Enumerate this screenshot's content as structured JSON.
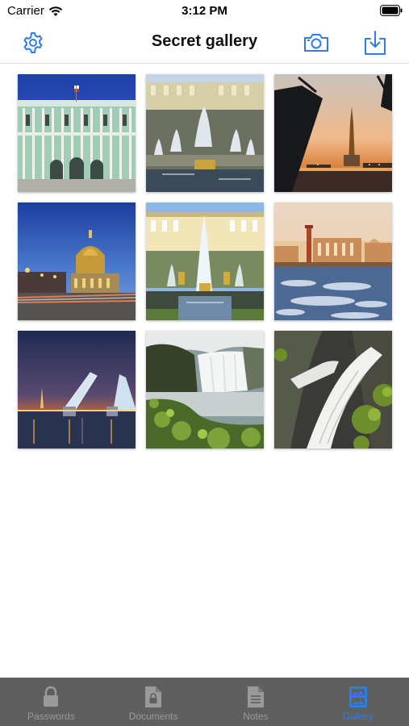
{
  "status_bar": {
    "carrier": "Carrier",
    "time": "3:12 PM"
  },
  "nav": {
    "title": "Secret gallery",
    "left_icon": "settings-gear-icon",
    "right_icons": [
      "camera-icon",
      "import-download-icon"
    ]
  },
  "gallery": {
    "photos": [
      {
        "subject": "palace-facade"
      },
      {
        "subject": "palace-fountains"
      },
      {
        "subject": "drawbridge-cathedral-sunset"
      },
      {
        "subject": "cathedral-dome-night"
      },
      {
        "subject": "grand-cascade-fountain"
      },
      {
        "subject": "rostral-column-winter"
      },
      {
        "subject": "drawbridge-night"
      },
      {
        "subject": "waterfall-green"
      },
      {
        "subject": "waterfall-bw"
      }
    ]
  },
  "tabs": [
    {
      "label": "Passwords",
      "icon": "lock-icon",
      "active": false
    },
    {
      "label": "Documents",
      "icon": "document-lock-icon",
      "active": false
    },
    {
      "label": "Notes",
      "icon": "note-icon",
      "active": false
    },
    {
      "label": "Gallery",
      "icon": "gallery-icon",
      "active": true
    }
  ],
  "colors": {
    "accent": "#2f7de1",
    "tab_bar": "#5f5f5f",
    "tab_inactive": "#9a9a9a"
  }
}
